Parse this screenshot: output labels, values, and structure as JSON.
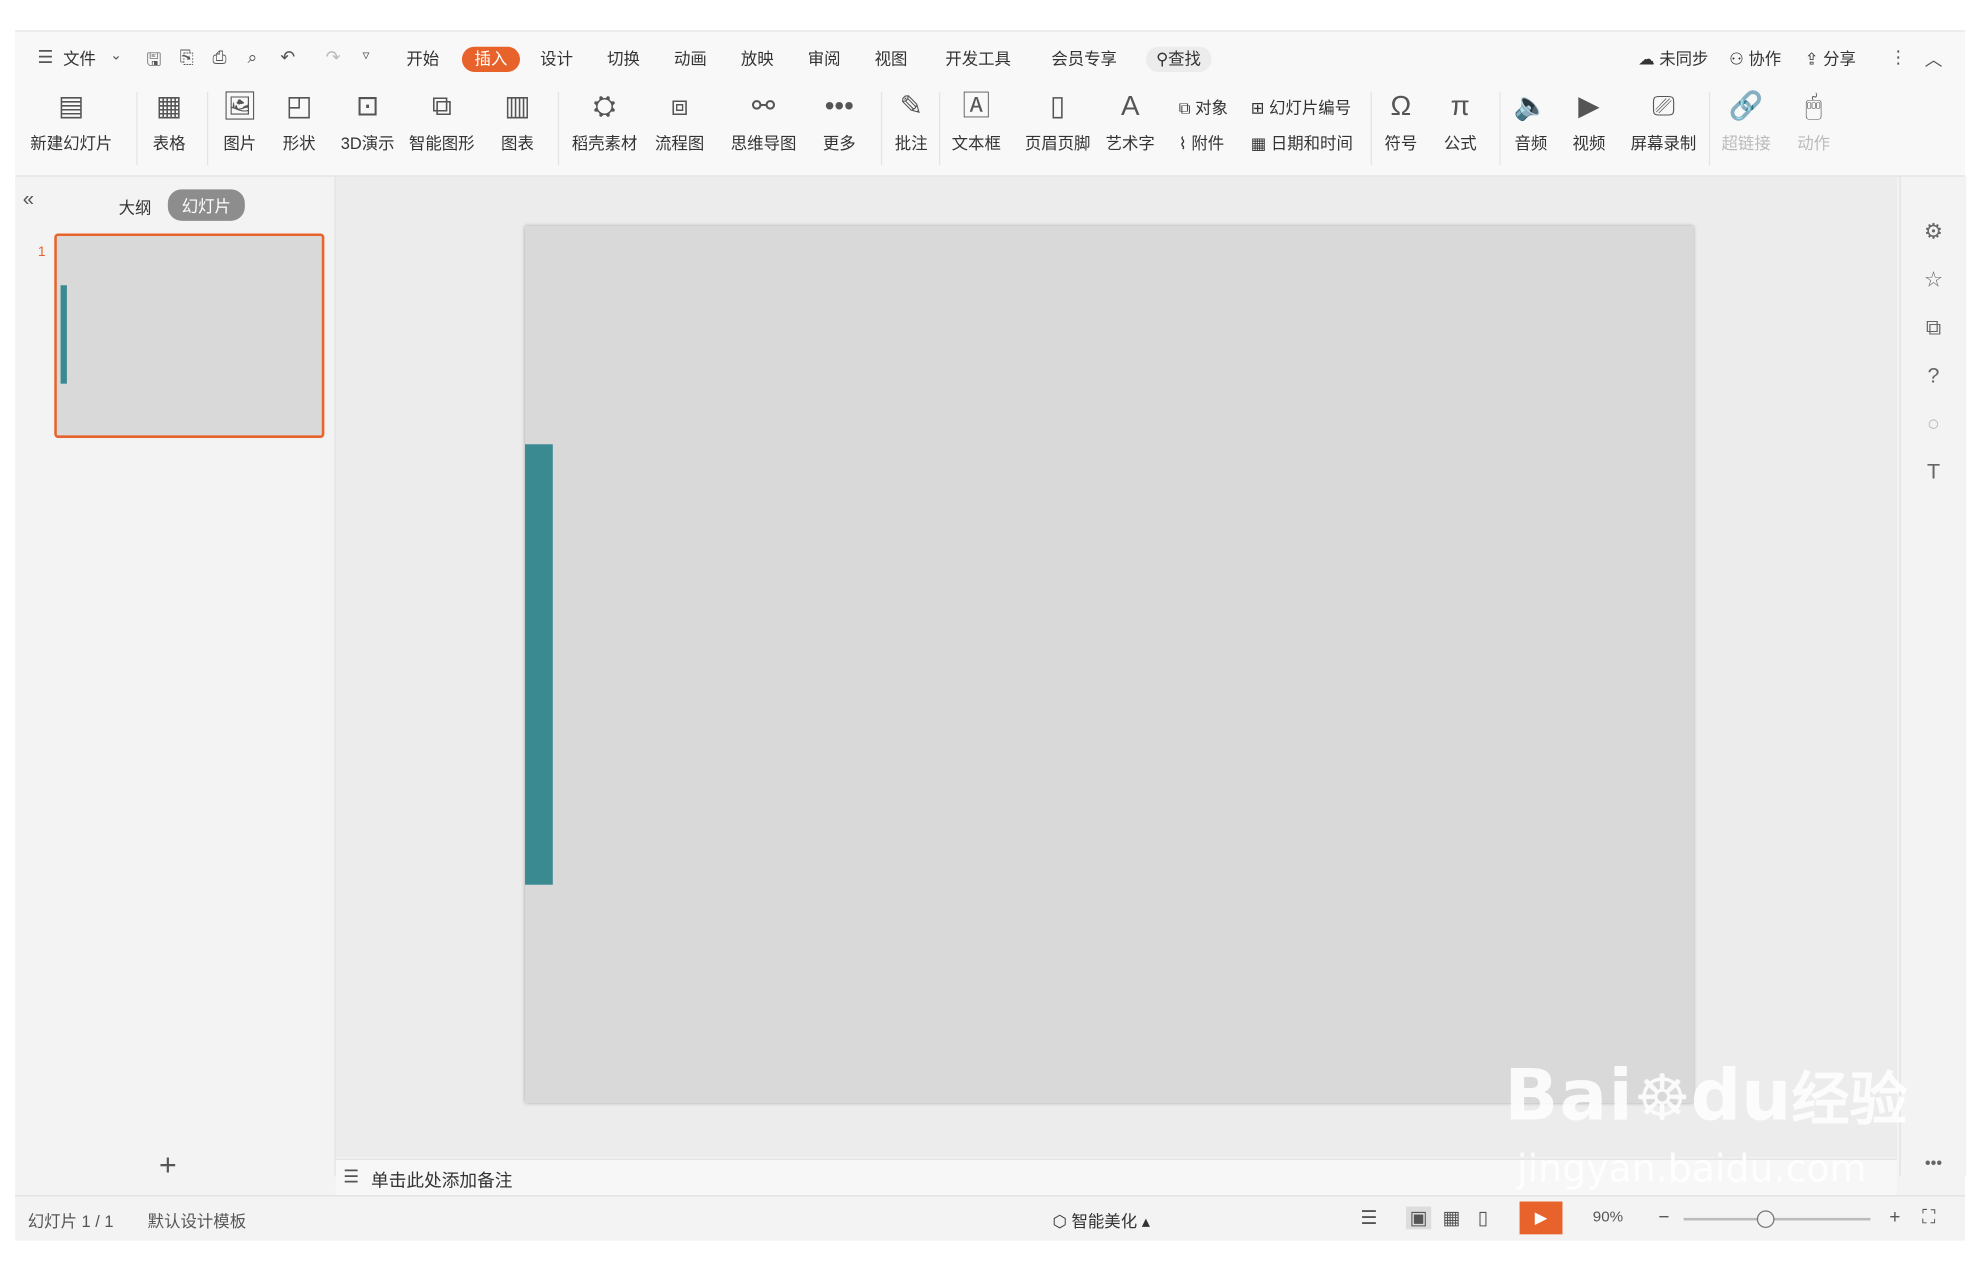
{
  "tabs": [
    "文件",
    "开始",
    "插入",
    "设计",
    "切换",
    "动画",
    "放映",
    "审阅",
    "视图",
    "开发工具",
    "会员专享"
  ],
  "active_tab": "插入",
  "search_label": "查找",
  "top_right": {
    "sync": "未同步",
    "collab": "协作",
    "share": "分享"
  },
  "ribbon": {
    "new_slide": "新建幻灯片",
    "table": "表格",
    "picture": "图片",
    "shape": "形状",
    "demo3d": "3D演示",
    "smart_graphic": "智能图形",
    "chart": "图表",
    "material": "稻壳素材",
    "flowchart": "流程图",
    "mindmap": "思维导图",
    "more": "更多",
    "comment": "批注",
    "textbox": "文本框",
    "header_footer": "页眉页脚",
    "art_text": "艺术字",
    "object": "对象",
    "slide_number": "幻灯片编号",
    "attachment": "附件",
    "datetime": "日期和时间",
    "symbol": "符号",
    "formula": "公式",
    "audio": "音频",
    "video": "视频",
    "screen_record": "屏幕录制",
    "hyperlink": "超链接",
    "action": "动作"
  },
  "panel": {
    "outline_tab": "大纲",
    "slides_tab": "幻灯片",
    "slide_index": "1"
  },
  "notes_placeholder": "单击此处添加备注",
  "status": {
    "slide_info": "幻灯片 1 / 1",
    "template": "默认设计模板",
    "beautify": "智能美化",
    "zoom": "90%"
  },
  "colors": {
    "accent_tab": "#e8632b",
    "slide_bar": "#3a8a92",
    "slide_bg": "#d9d9d9"
  },
  "watermark": {
    "brand": "Bai",
    "brand2": "du",
    "cn": "经验",
    "url": "jingyan.baidu.com"
  }
}
